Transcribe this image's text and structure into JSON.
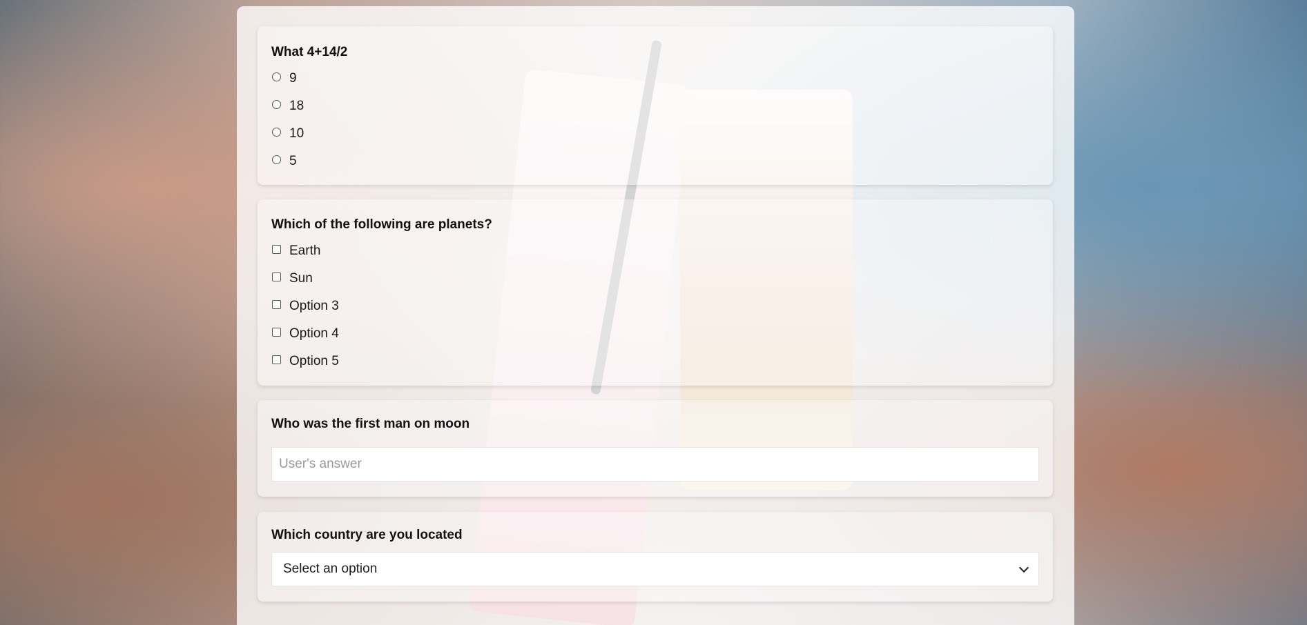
{
  "questions": [
    {
      "title": "What 4+14/2",
      "type": "radio",
      "options": [
        "9",
        "18",
        "10",
        "5"
      ]
    },
    {
      "title": "Which of the following are planets?",
      "type": "checkbox",
      "options": [
        "Earth",
        "Sun",
        "Option 3",
        "Option 4",
        "Option 5"
      ]
    },
    {
      "title": "Who was the first man on moon",
      "type": "text",
      "placeholder": "User's answer"
    },
    {
      "title": "Which country are you located",
      "type": "select",
      "selected": "Select an option"
    }
  ]
}
